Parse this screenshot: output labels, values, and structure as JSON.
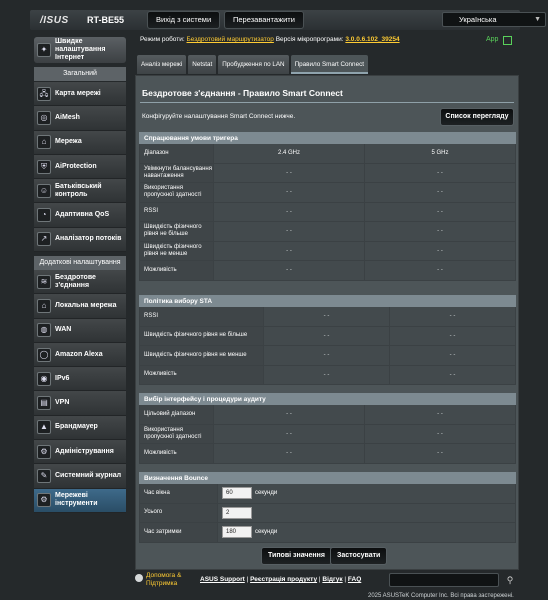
{
  "header": {
    "logo": "/ISUS",
    "model": "RT-BE55",
    "logout_label": "Вихід з системи",
    "reboot_label": "Перезавантажити",
    "language": "Українська"
  },
  "status": {
    "mode_label": "Режим роботи:",
    "mode_value": "Бездротовий маршрутизатор",
    "fw_label": "Версія мікропрограми:",
    "fw_value": "3.0.0.6.102_39254",
    "app_label": "App"
  },
  "sidebar": {
    "quick_setup": "Швидке налаштування Інтернет",
    "general_header": "Загальний",
    "general_items": [
      {
        "label": "Карта мережі",
        "icon": "network-map-icon",
        "glyph": "🖧"
      },
      {
        "label": "AiMesh",
        "icon": "aimesh-icon",
        "glyph": "◎"
      },
      {
        "label": "Мережа",
        "icon": "network-icon",
        "glyph": "⌂"
      },
      {
        "label": "AiProtection",
        "icon": "shield-icon",
        "glyph": "⛨"
      },
      {
        "label": "Батьківський контроль",
        "icon": "parental-control-icon",
        "glyph": "☺"
      },
      {
        "label": "Адаптивна QoS",
        "icon": "qos-icon",
        "glyph": "◔"
      },
      {
        "label": "Аналізатор потоків",
        "icon": "traffic-analyzer-icon",
        "glyph": "↗"
      }
    ],
    "advanced_header": "Додаткові налаштування",
    "advanced_items": [
      {
        "label": "Бездротове з'єднання",
        "icon": "wireless-icon",
        "glyph": "≋"
      },
      {
        "label": "Локальна мережа",
        "icon": "lan-icon",
        "glyph": "⌂"
      },
      {
        "label": "WAN",
        "icon": "wan-icon",
        "glyph": "◍"
      },
      {
        "label": "Amazon Alexa",
        "icon": "alexa-icon",
        "glyph": "◯"
      },
      {
        "label": "IPv6",
        "icon": "ipv6-icon",
        "glyph": "◉"
      },
      {
        "label": "VPN",
        "icon": "vpn-icon",
        "glyph": "▤"
      },
      {
        "label": "Брандмауер",
        "icon": "firewall-icon",
        "glyph": "▲"
      },
      {
        "label": "Адміністрування",
        "icon": "admin-icon",
        "glyph": "⚙"
      },
      {
        "label": "Системний журнал",
        "icon": "system-log-icon",
        "glyph": "✎"
      },
      {
        "label": "Мережеві інструменти",
        "icon": "network-tools-icon",
        "glyph": "⚙",
        "active": true
      }
    ]
  },
  "tabs": [
    {
      "label": "Аналіз мережі"
    },
    {
      "label": "Netstat"
    },
    {
      "label": "Пробудження по LAN"
    },
    {
      "label": "Правило Smart Connect",
      "active": true
    }
  ],
  "panel": {
    "title": "Бездротове з'єднання - Правило Smart Connect",
    "description": "Конфігуруйте налаштування Smart Connect нижче.",
    "list_button": "Список перегляду"
  },
  "trigger": {
    "header": "Спрацювання умови тригера",
    "band_label": "Діапазон",
    "band_24": "2.4 GHz",
    "band_5": "5 GHz",
    "rows": [
      {
        "label": "Увімкнути балансування навантаження",
        "v1": "- -",
        "v2": "- -"
      },
      {
        "label": "Використання пропускної здатності",
        "v1": "- -",
        "v2": "- -"
      },
      {
        "label": "RSSI",
        "v1": "- -",
        "v2": "- -"
      },
      {
        "label": "Швидкість фізичного рівня не більше",
        "v1": "- -",
        "v2": "- -"
      },
      {
        "label": "Швидкість фізичного рівня не менше",
        "v1": "- -",
        "v2": "- -"
      },
      {
        "label": "Можливість",
        "v1": "- -",
        "v2": "- -"
      }
    ]
  },
  "sta": {
    "header": "Політика вибору STA",
    "rows": [
      {
        "label": "RSSI",
        "v1": "- -",
        "v2": "- -"
      },
      {
        "label": "Швидкість фізичного рівня не більше",
        "v1": "- -",
        "v2": "- -"
      },
      {
        "label": "Швидкість фізичного рівня не менше",
        "v1": "- -",
        "v2": "- -"
      },
      {
        "label": "Можливість",
        "v1": "- -",
        "v2": "- -"
      }
    ]
  },
  "audit": {
    "header": "Вибір інтерфейсу і процедури аудиту",
    "rows": [
      {
        "label": "Цільовий діапазон",
        "v1": "- -",
        "v2": "- -"
      },
      {
        "label": "Використання пропускної здатності",
        "v1": "- -",
        "v2": "- -"
      },
      {
        "label": "Можливість",
        "v1": "- -",
        "v2": "- -"
      }
    ]
  },
  "bounce": {
    "header": "Визначення Bounce",
    "rows": [
      {
        "label": "Час вікна",
        "value": "60",
        "unit": "секунди"
      },
      {
        "label": "Усього",
        "value": "2",
        "unit": ""
      },
      {
        "label": "Час затримки",
        "value": "180",
        "unit": "секунди"
      }
    ]
  },
  "actions": {
    "defaults": "Типові значення",
    "apply": "Застосувати"
  },
  "footer": {
    "help": "Допомога & Підтримка",
    "links": [
      "ASUS Support",
      "Реєстрація продукту",
      "Відгук",
      "FAQ"
    ],
    "copyright": "2025 ASUSTeK Computer Inc. Всі права застережені."
  }
}
